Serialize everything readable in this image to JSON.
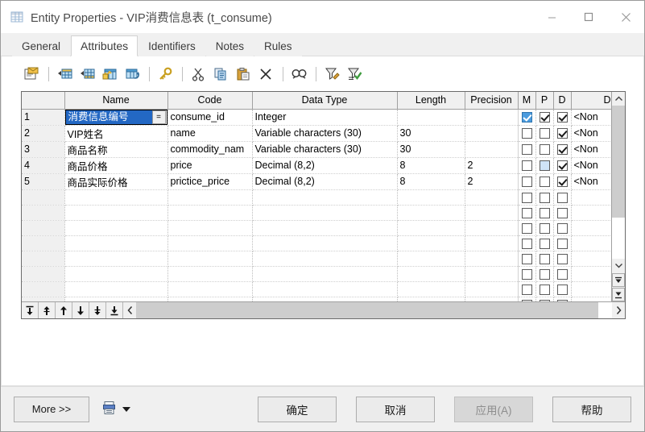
{
  "window": {
    "title": "Entity Properties - VIP消费信息表 (t_consume)",
    "icon": "table-icon",
    "controls": {
      "minimize": "minimize-icon",
      "maximize": "maximize-icon",
      "close": "close-icon"
    }
  },
  "tabs": [
    {
      "label": "General",
      "active": false
    },
    {
      "label": "Attributes",
      "active": true
    },
    {
      "label": "Identifiers",
      "active": false
    },
    {
      "label": "Notes",
      "active": false
    },
    {
      "label": "Rules",
      "active": false
    }
  ],
  "toolbar": {
    "buttons": [
      {
        "name": "properties-icon",
        "title": "Properties"
      },
      {
        "name": "insert-row-icon",
        "title": "Insert a Row"
      },
      {
        "name": "add-row-icon",
        "title": "Add a Row"
      },
      {
        "name": "add-new-icon",
        "title": "Create an Object"
      },
      {
        "name": "replicate-icon",
        "title": "Replicate"
      },
      {
        "name": "key-icon",
        "title": "Primary Key"
      },
      {
        "name": "cut-icon",
        "title": "Cut"
      },
      {
        "name": "copy-icon",
        "title": "Copy"
      },
      {
        "name": "paste-icon",
        "title": "Paste"
      },
      {
        "name": "delete-icon",
        "title": "Delete"
      },
      {
        "name": "find-icon",
        "title": "Find"
      },
      {
        "name": "filter-edit-icon",
        "title": "Customize Columns and Filter"
      },
      {
        "name": "filter-apply-icon",
        "title": "Apply Filter"
      }
    ]
  },
  "grid": {
    "columns": [
      {
        "key": "rownum",
        "label": ""
      },
      {
        "key": "name",
        "label": "Name"
      },
      {
        "key": "code",
        "label": "Code"
      },
      {
        "key": "datatype",
        "label": "Data Type"
      },
      {
        "key": "length",
        "label": "Length"
      },
      {
        "key": "precision",
        "label": "Precision"
      },
      {
        "key": "m",
        "label": "M"
      },
      {
        "key": "p",
        "label": "P"
      },
      {
        "key": "d",
        "label": "D"
      },
      {
        "key": "domain",
        "label": "D"
      }
    ],
    "rows": [
      {
        "rownum": "1",
        "name": "消费信息编号",
        "code": "consume_id",
        "datatype": "Integer",
        "length": "",
        "precision": "",
        "m": true,
        "p": true,
        "d": true,
        "domain": "<Non",
        "selected": true,
        "editing": true,
        "ellipsis_label": "="
      },
      {
        "rownum": "2",
        "name": "VIP姓名",
        "code": "name",
        "datatype": "Variable characters (30)",
        "length": "30",
        "precision": "",
        "m": false,
        "p": false,
        "d": true,
        "domain": "<Non"
      },
      {
        "rownum": "3",
        "name": "商品名称",
        "code": "commodity_nam",
        "datatype": "Variable characters (30)",
        "length": "30",
        "precision": "",
        "m": false,
        "p": false,
        "d": true,
        "domain": "<Non"
      },
      {
        "rownum": "4",
        "name": "商品价格",
        "code": "price",
        "datatype": "Decimal (8,2)",
        "length": "8",
        "precision": "2",
        "m": false,
        "p": false,
        "p_highlight": true,
        "d": true,
        "domain": "<Non"
      },
      {
        "rownum": "5",
        "name": "商品实际价格",
        "code": "prictice_price",
        "datatype": "Decimal (8,2)",
        "length": "8",
        "precision": "2",
        "m": false,
        "p": false,
        "d": true,
        "domain": "<Non"
      }
    ],
    "empty_row_count": 14,
    "move_buttons": [
      {
        "name": "move-to-top-icon"
      },
      {
        "name": "move-up-fast-icon"
      },
      {
        "name": "move-up-icon"
      },
      {
        "name": "move-down-icon"
      },
      {
        "name": "move-down-fast-icon"
      },
      {
        "name": "move-to-bottom-icon"
      }
    ],
    "scroll": {
      "vertical_up": "scroll-up-icon",
      "vertical_down": "scroll-down-icon",
      "page_top": "page-top-icon",
      "page_bottom": "page-bottom-icon",
      "horizontal_left": "scroll-left-icon",
      "horizontal_right": "scroll-right-icon"
    }
  },
  "footer": {
    "more_label": "More >>",
    "print_icon": "print-report-icon",
    "print_dropdown": "dropdown-caret-icon",
    "ok_label": "确定",
    "cancel_label": "取消",
    "apply_label": "应用(A)",
    "help_label": "帮助",
    "apply_disabled": true
  },
  "colors": {
    "selection_blue": "#2368c4",
    "checkbox_selected": "#4a9bde",
    "checkbox_highlight": "#cfe3f7",
    "window_bg": "#f0f0f0",
    "panel_bg": "#ffffff"
  }
}
